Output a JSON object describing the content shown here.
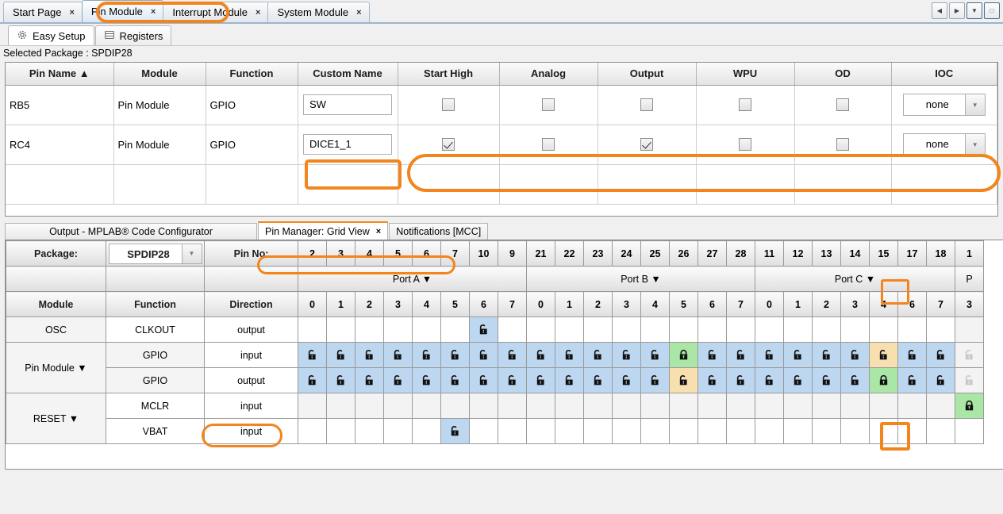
{
  "window": {
    "editor_tabs": [
      {
        "label": "Start Page",
        "close": "×",
        "active": false
      },
      {
        "label": "Pin Module",
        "close": "×",
        "active": true
      },
      {
        "label": "Interrupt Module",
        "close": "×",
        "active": false
      },
      {
        "label": "System Module",
        "close": "×",
        "active": false
      }
    ],
    "window_buttons": [
      {
        "name": "scroll-left-button",
        "glyph": "◀"
      },
      {
        "name": "scroll-right-button",
        "glyph": "▶"
      },
      {
        "name": "tab-list-dropdown-button",
        "glyph": "▼"
      },
      {
        "name": "maximize-button",
        "glyph": "□"
      }
    ]
  },
  "pin_module": {
    "sub_tabs": [
      {
        "label": "Easy Setup",
        "icon": "gear-icon",
        "active": true
      },
      {
        "label": "Registers",
        "icon": "registers-icon",
        "active": false
      }
    ],
    "selected_package_label": "Selected Package : SPDIP28",
    "table": {
      "headers": [
        "Pin Name ▲",
        "Module",
        "Function",
        "Custom Name",
        "Start High",
        "Analog",
        "Output",
        "WPU",
        "OD",
        "IOC"
      ],
      "rows": [
        {
          "pin_name": "RB5",
          "module": "Pin Module",
          "function": "GPIO",
          "custom_name": "SW",
          "start_high": false,
          "analog": false,
          "output": false,
          "wpu": false,
          "od": false,
          "ioc": "none"
        },
        {
          "pin_name": "RC4",
          "module": "Pin Module",
          "function": "GPIO",
          "custom_name": "DICE1_1",
          "start_high": true,
          "analog": false,
          "output": true,
          "wpu": false,
          "od": false,
          "ioc": "none"
        }
      ]
    }
  },
  "bottom_dock": {
    "tabs": [
      {
        "label": "Output - MPLAB® Code Configurator",
        "active": false,
        "close": ""
      },
      {
        "label": "Pin Manager: Grid View",
        "active": true,
        "close": "×"
      },
      {
        "label": "Notifications [MCC]",
        "active": false,
        "close": ""
      }
    ],
    "package_label": "Package:",
    "package_value": "SPDIP28",
    "pin_no_label": "Pin No:",
    "column_headers": [
      "Module",
      "Function",
      "Direction"
    ],
    "pin_numbers": [
      "2",
      "3",
      "4",
      "5",
      "6",
      "7",
      "10",
      "9",
      "21",
      "22",
      "23",
      "24",
      "25",
      "26",
      "27",
      "28",
      "11",
      "12",
      "13",
      "14",
      "15",
      "17",
      "18",
      "1"
    ],
    "ports": [
      {
        "label": "Port A ▼",
        "bits": [
          "0",
          "1",
          "2",
          "3",
          "4",
          "5",
          "6",
          "7"
        ]
      },
      {
        "label": "Port B ▼",
        "bits": [
          "0",
          "1",
          "2",
          "3",
          "4",
          "5",
          "6",
          "7"
        ]
      },
      {
        "label": "Port C ▼",
        "bits": [
          "0",
          "1",
          "2",
          "3",
          "4",
          "6",
          "7"
        ]
      },
      {
        "label": "P",
        "bits": [
          "3"
        ]
      }
    ],
    "rows": [
      {
        "module": "OSC",
        "function": "CLKOUT",
        "direction": "output",
        "cells": [
          "",
          "",
          "",
          "",
          "",
          "",
          "blue-unlocked",
          "",
          "",
          "",
          "",
          "",
          "",
          "",
          "",
          "",
          "",
          "",
          "",
          "",
          "",
          "",
          "",
          "na"
        ]
      },
      {
        "module": "Pin Module ▼",
        "function": "GPIO",
        "direction": "input",
        "cells": [
          "blue-unlocked",
          "blue-unlocked",
          "blue-unlocked",
          "blue-unlocked",
          "blue-unlocked",
          "blue-unlocked",
          "blue-unlocked",
          "blue-unlocked",
          "blue-unlocked",
          "blue-unlocked",
          "blue-unlocked",
          "blue-unlocked",
          "blue-unlocked",
          "green-locked",
          "blue-unlocked",
          "blue-unlocked",
          "blue-unlocked",
          "blue-unlocked",
          "blue-unlocked",
          "blue-unlocked",
          "orange-unlocked",
          "blue-unlocked",
          "blue-unlocked",
          "grey-unlocked"
        ]
      },
      {
        "module": "",
        "function": "GPIO",
        "direction": "output",
        "cells": [
          "blue-unlocked",
          "blue-unlocked",
          "blue-unlocked",
          "blue-unlocked",
          "blue-unlocked",
          "blue-unlocked",
          "blue-unlocked",
          "blue-unlocked",
          "blue-unlocked",
          "blue-unlocked",
          "blue-unlocked",
          "blue-unlocked",
          "blue-unlocked",
          "orange-unlocked",
          "blue-unlocked",
          "blue-unlocked",
          "blue-unlocked",
          "blue-unlocked",
          "blue-unlocked",
          "blue-unlocked",
          "green-locked",
          "blue-unlocked",
          "blue-unlocked",
          "grey-unlocked"
        ]
      },
      {
        "module": "RESET ▼",
        "function": "MCLR",
        "direction": "input",
        "cells": [
          "grey",
          "grey",
          "grey",
          "grey",
          "grey",
          "grey",
          "grey",
          "grey",
          "grey",
          "grey",
          "grey",
          "grey",
          "grey",
          "grey",
          "grey",
          "grey",
          "grey",
          "grey",
          "grey",
          "grey",
          "grey",
          "grey",
          "grey",
          "green-locked"
        ]
      },
      {
        "module": "",
        "function": "VBAT",
        "direction": "input",
        "cells": [
          "",
          "",
          "",
          "",
          "",
          "blue-unlocked",
          "",
          "",
          "",
          "",
          "",
          "",
          "",
          "",
          "",
          "",
          "",
          "",
          "",
          "",
          "",
          "",
          "",
          ""
        ]
      }
    ]
  },
  "colors": {
    "highlight": "#f2851e",
    "cell_blue": "#bdd7f0",
    "cell_green": "#aae6a5",
    "cell_orange": "#f7dfb0"
  },
  "annotations": [
    {
      "name": "highlight-pin-module-tab"
    },
    {
      "name": "highlight-custom-name-dice1-1"
    },
    {
      "name": "highlight-rc4-row-settings"
    },
    {
      "name": "highlight-pin-manager-grid-view-tab"
    },
    {
      "name": "highlight-pin-number-15"
    },
    {
      "name": "highlight-direction-output"
    },
    {
      "name": "highlight-portc4-output-lock"
    }
  ]
}
